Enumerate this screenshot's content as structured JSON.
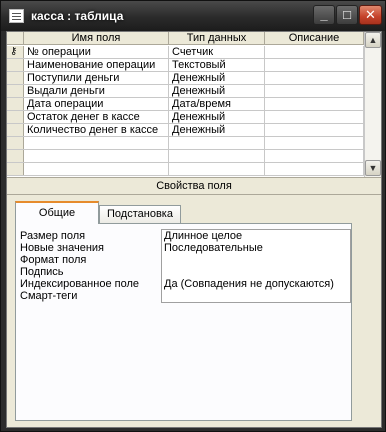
{
  "window": {
    "title": "касса : таблица",
    "minimize_symbol": "_",
    "maximize_symbol": "□",
    "close_symbol": "✕"
  },
  "grid": {
    "columns": [
      "Имя поля",
      "Тип данных",
      "Описание"
    ],
    "rows": [
      {
        "name": "№ операции",
        "type": "Счетчик",
        "description": "",
        "key": true
      },
      {
        "name": "Наименование операции",
        "type": "Текстовый",
        "description": ""
      },
      {
        "name": "Поступили  деньги",
        "type": "Денежный",
        "description": ""
      },
      {
        "name": "Выдали деньги",
        "type": "Денежный",
        "description": ""
      },
      {
        "name": "Дата  операции",
        "type": "Дата/время",
        "description": ""
      },
      {
        "name": "Остаток денег в кассе",
        "type": "Денежный",
        "description": ""
      },
      {
        "name": "Количество денег в кассе",
        "type": "Денежный",
        "description": ""
      },
      {
        "name": "",
        "type": "",
        "description": ""
      },
      {
        "name": "",
        "type": "",
        "description": ""
      },
      {
        "name": "",
        "type": "",
        "description": ""
      }
    ],
    "key_icon": "key-icon",
    "scroll_up_symbol": "▲",
    "scroll_down_symbol": "▼"
  },
  "properties": {
    "header": "Свойства поля",
    "tabs": [
      "Общие",
      "Подстановка"
    ],
    "active_tab": "Общие",
    "rows": [
      {
        "label": "Размер поля",
        "value": "Длинное целое"
      },
      {
        "label": "Новые значения",
        "value": "Последовательные"
      },
      {
        "label": "Формат поля",
        "value": ""
      },
      {
        "label": "Подпись",
        "value": ""
      },
      {
        "label": "Индексированное поле",
        "value": "Да (Совпадения не допускаются)"
      },
      {
        "label": "Смарт-теги",
        "value": ""
      }
    ]
  },
  "colors": {
    "titlebar": "#2a2a2a",
    "chrome": "#ece9d8",
    "active_tab_accent": "#e68b2c",
    "close_button": "#c5412a"
  }
}
